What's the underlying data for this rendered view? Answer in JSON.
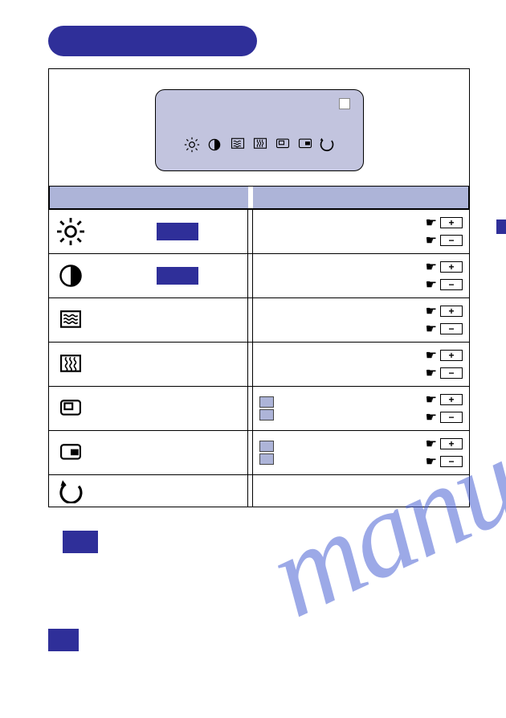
{
  "watermark": "manualshive.com",
  "plus": "+",
  "minus": "−",
  "osd_icons": [
    "brightness",
    "contrast",
    "h-ripple",
    "v-ripple",
    "size",
    "position",
    "recall"
  ],
  "rows": [
    {
      "id": "brightness",
      "has_block": true,
      "has_pm": true,
      "has_mini": false
    },
    {
      "id": "contrast",
      "has_block": true,
      "has_pm": true,
      "has_mini": false
    },
    {
      "id": "h-ripple",
      "has_block": false,
      "has_pm": true,
      "has_mini": false
    },
    {
      "id": "v-ripple",
      "has_block": false,
      "has_pm": true,
      "has_mini": false
    },
    {
      "id": "size",
      "has_block": false,
      "has_pm": true,
      "has_mini": true
    },
    {
      "id": "position",
      "has_block": false,
      "has_pm": true,
      "has_mini": true
    },
    {
      "id": "recall",
      "has_block": false,
      "has_pm": false,
      "has_mini": false
    }
  ]
}
